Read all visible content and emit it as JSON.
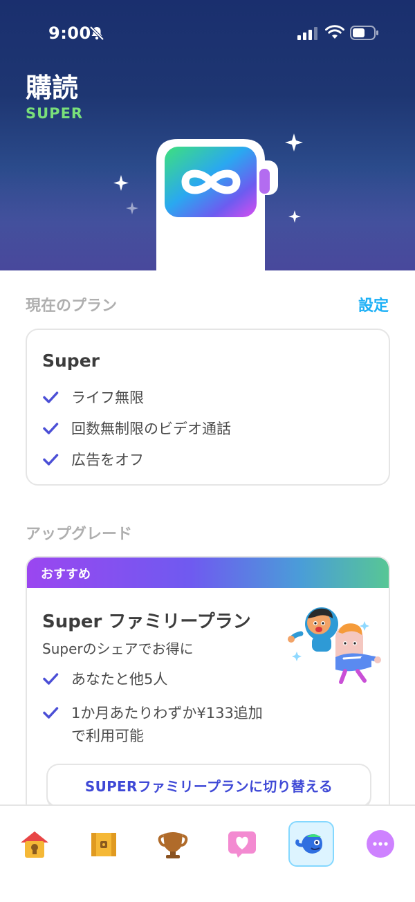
{
  "status_bar": {
    "time": "9:00"
  },
  "header": {
    "title": "購読",
    "subtitle": "SUPER"
  },
  "current_plan": {
    "section_label": "現在のプラン",
    "settings_link": "設定",
    "plan_name": "Super",
    "features": [
      "ライフ無限",
      "回数無制限のビデオ通話",
      "広告をオフ"
    ]
  },
  "upgrade": {
    "section_label": "アップグレード",
    "badge": "おすすめ",
    "title": "Super ファミリープラン",
    "subtitle": "Superのシェアでお得に",
    "features": [
      "あなたと他5人",
      "1か月あたりわずか¥133追加",
      "で利用可能"
    ],
    "button_label": "SUPERファミリープランに切り替える"
  },
  "bottom_nav": {
    "items": [
      "home-icon",
      "chest-icon",
      "trophy-icon",
      "heart-icon",
      "super-icon",
      "more-icon"
    ],
    "active": "super-icon"
  },
  "colors": {
    "accent_blue": "#1cb0f6",
    "link_purple": "#3f49d6",
    "super_green": "#79e07a",
    "check": "#4b4fd6"
  }
}
